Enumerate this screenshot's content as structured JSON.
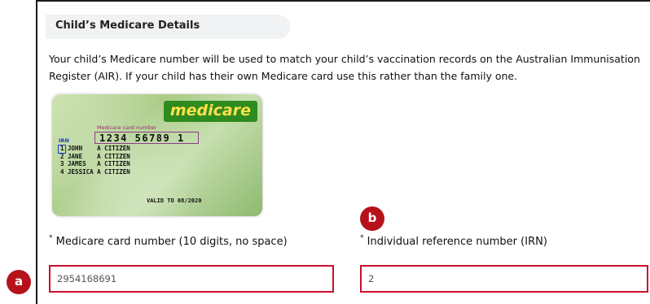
{
  "section": {
    "title": "Child’s Medicare Details"
  },
  "intro_text": "Your child’s Medicare number will be used to match your child’s vaccination records on the Australian Immunisation Register (AIR). If your child has their own Medicare card use this rather than the family one.",
  "card": {
    "logo": "medicare",
    "number_label": "Medicare card number",
    "number": "1234 56789 1",
    "irn_label": "IRN",
    "names": [
      "1 JOHN    A CITIZEN",
      "2 JANE    A CITIZEN",
      "3 JAMES   A CITIZEN",
      "4 JESSICA A CITIZEN"
    ],
    "valid_to": "VALID TO  08/2020"
  },
  "fields": {
    "medicare": {
      "required_mark": "*",
      "label": "Medicare card number (10 digits, no space)",
      "value": "2954168691"
    },
    "irn": {
      "required_mark": "*",
      "label": "Individual reference number (IRN)",
      "value": "2"
    }
  },
  "markers": {
    "a": "a",
    "b": "b"
  },
  "colors": {
    "accent": "#c8102e",
    "marker": "#b5121b",
    "header_bg": "#f1f2f3",
    "medicare_green": "#2e8b1e"
  }
}
